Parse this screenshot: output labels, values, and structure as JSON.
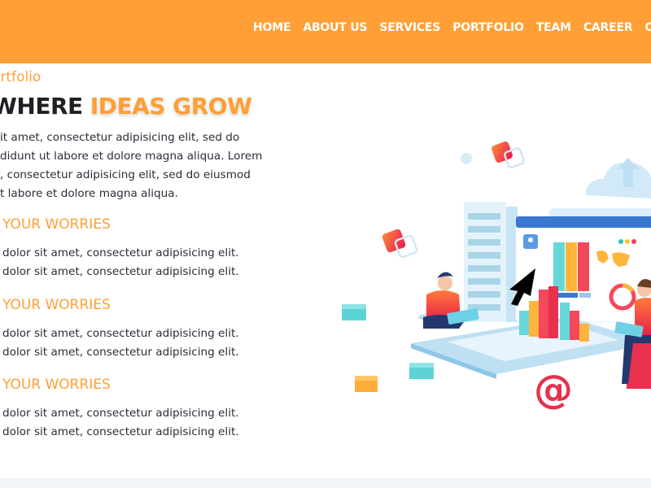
{
  "nav": {
    "items": [
      "HOME",
      "ABOUT US",
      "SERVICES",
      "PORTFOLIO",
      "TEAM",
      "CAREER",
      "CONT"
    ]
  },
  "hero": {
    "breadcrumb": "ortfolio",
    "headline_dark": "WHERE ",
    "headline_accent": "IDEAS GROW",
    "intro_lines": [
      "it amet, consectetur adipisicing elit, sed do",
      "didunt ut labore et dolore magna aliqua. Lorem",
      ", consectetur adipisicing elit, sed do eiusmod",
      "t labore et dolore magna aliqua."
    ]
  },
  "features": [
    {
      "title": "YOUR WORRIES",
      "lines": [
        "dolor sit amet, consectetur adipisicing elit.",
        "dolor sit amet, consectetur adipisicing elit."
      ]
    },
    {
      "title": "YOUR WORRIES",
      "lines": [
        "dolor sit amet, consectetur adipisicing elit.",
        "dolor sit amet, consectetur adipisicing elit."
      ]
    },
    {
      "title": "YOUR WORRIES",
      "lines": [
        "dolor sit amet, consectetur adipisicing elit.",
        "dolor sit amet, consectetur adipisicing elit."
      ]
    }
  ],
  "illustration": {
    "at_symbol": "@"
  },
  "colors": {
    "brand": "#FF9F36",
    "text": "#2b2d38",
    "heading": "#1f2024"
  }
}
